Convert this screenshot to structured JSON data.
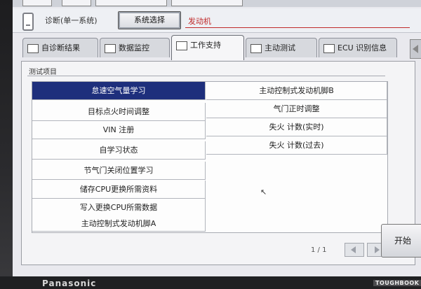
{
  "header": {
    "breadcrumb": "诊断(单一系统)",
    "system_select_button": "系统选择",
    "system_label": "发动机"
  },
  "tabs": [
    {
      "label": "自诊断结果",
      "icon": "document-icon",
      "active": false
    },
    {
      "label": "数据监控",
      "icon": "monitor-icon",
      "active": false
    },
    {
      "label": "工作支持",
      "icon": "wrench-icon",
      "active": true
    },
    {
      "label": "主动测试",
      "icon": "test-icon",
      "active": false
    },
    {
      "label": "ECU 识别信息",
      "icon": "ecu-icon",
      "active": false
    }
  ],
  "panel": {
    "title": "测试项目",
    "left_items": [
      "怠速空气量学习",
      "目标点火时间调整",
      "VIN 注册",
      "自学习状态",
      "节气门关闭位置学习",
      "储存CPU更换所需资料",
      "写入更换CPU所需数据",
      "主动控制式发动机脚A"
    ],
    "right_items": [
      "主动控制式发动机脚B",
      "气门正时调整",
      "失火 计数(实时)",
      "失火 计数(过去)"
    ],
    "selected_index": 0
  },
  "pager": {
    "text": "1 / 1"
  },
  "start_button": "开始",
  "device_brand": "Panasonic",
  "device_brand_right": "TOUGHBOOK"
}
